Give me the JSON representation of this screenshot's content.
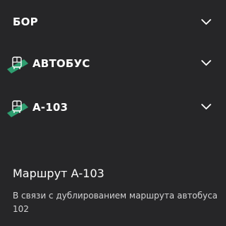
{
  "filters": {
    "location": {
      "label": "БОР",
      "icon": "chevron-down-icon"
    },
    "transport_type": {
      "label": "АВТОБУС",
      "icon": "bus-icon",
      "accent": "#2e9e70"
    },
    "route": {
      "label": "А-103",
      "icon": "bus-icon",
      "accent": "#2e9e70"
    }
  },
  "route_info": {
    "title": "Маршрут А-103",
    "description": "В связи с дублированием маршрута автобуса 102"
  },
  "colors": {
    "background": "#262628",
    "text": "#ffffff",
    "muted_text": "#d2d2d4",
    "accent": "#2e9e70"
  }
}
